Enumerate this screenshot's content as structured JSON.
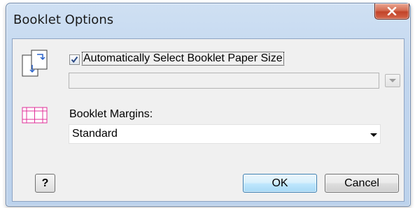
{
  "window": {
    "title": "Booklet Options",
    "close_icon": "close-icon"
  },
  "paper_size": {
    "icon": "paper-size-icon",
    "checkbox_checked": true,
    "checkbox_label": "Automatically Select Booklet Paper Size",
    "dropdown_value": "",
    "dropdown_disabled": true
  },
  "margins": {
    "icon": "booklet-margins-icon",
    "label": "Booklet Margins:",
    "selected": "Standard"
  },
  "buttons": {
    "help": "?",
    "ok": "OK",
    "cancel": "Cancel"
  },
  "colors": {
    "title_bar": "#c0d5ee",
    "close_button": "#c2442a",
    "margin_icon": "#e0309a",
    "ok_border": "#3c7fb1"
  }
}
